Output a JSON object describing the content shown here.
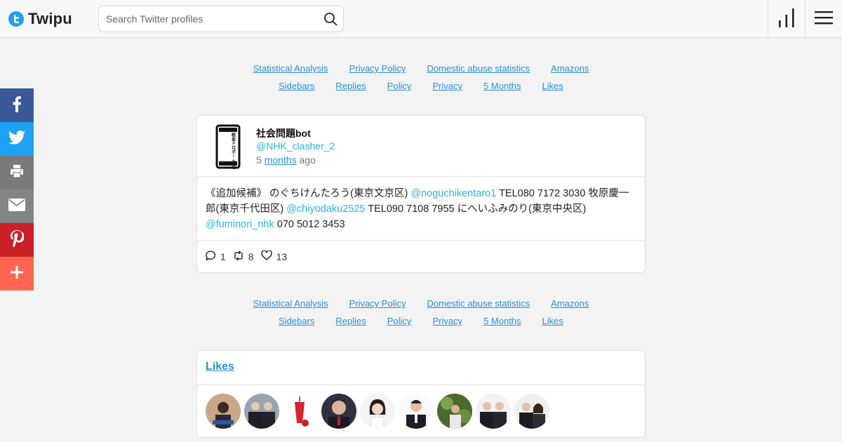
{
  "header": {
    "logo_text": "Twipu",
    "search_placeholder": "Search Twitter profiles"
  },
  "share": {
    "icons": [
      "facebook-icon",
      "twitter-icon",
      "print-icon",
      "email-icon",
      "pinterest-icon",
      "plus-icon"
    ],
    "colors": [
      "#3b5998",
      "#1da1f2",
      "#7a7a7a",
      "#848484",
      "#cb2027",
      "#ff6550"
    ]
  },
  "links": {
    "row1": [
      "Statistical Analysis",
      "Privacy Policy",
      "Domestic abuse statistics",
      "Amazons"
    ],
    "row2": [
      "Sidebars",
      "Replies",
      "Policy",
      "Privacy",
      "5 Months",
      "Likes"
    ]
  },
  "tweet": {
    "avatar_text": "税金ドロボー カネ返せ",
    "name": "社会問題bot",
    "handle": "@NHK_clasher_2",
    "time_prefix": "5",
    "time_link": "months",
    "time_suffix": "ago",
    "body": {
      "t1": "《追加候補》 のぐちけんたろう(東京文京区) ",
      "m1": "@noguchikentaro1",
      "t2": " TEL080 7172 3030 牧原慶一郎(東京千代田区) ",
      "m2": "@chiyodaku2525",
      "t3": " TEL090 7108 7955 にへいふみのり(東京中央区) ",
      "m3": "@fuminori_nhk",
      "t4": " 070 5012 3453"
    },
    "replies": "1",
    "retweets": "8",
    "likes": "13"
  },
  "likes_section": {
    "title": "Likes",
    "avatar_count": 9
  },
  "colors": {
    "accent": "#1da1f2",
    "link": "#2a8fd6",
    "mention": "#2ab3e6"
  }
}
